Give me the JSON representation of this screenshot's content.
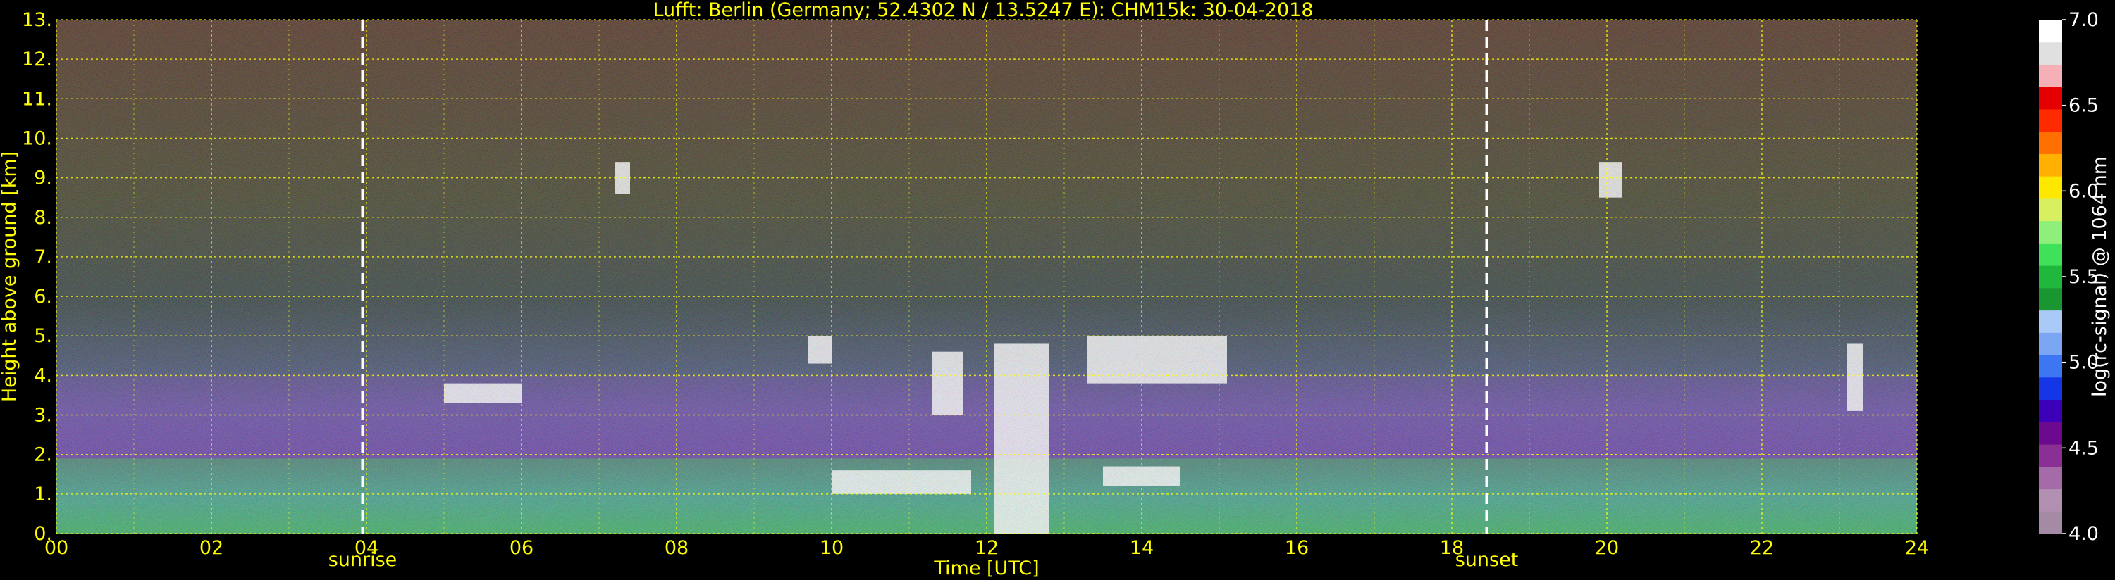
{
  "chart_data": {
    "type": "heatmap",
    "title": "Lufft: Berlin (Germany; 52.4302 N / 13.5247 E):    CHM15k: 30-04-2018",
    "xlabel": "Time [UTC]",
    "ylabel": "Height above ground [km]",
    "colorbar_label": "log(rc-signal) @ 1064 nm",
    "xlim": [
      0,
      24
    ],
    "ylim": [
      0,
      13
    ],
    "xticks": [
      "00",
      "02",
      "04",
      "06",
      "08",
      "10",
      "12",
      "14",
      "16",
      "18",
      "20",
      "22",
      "24"
    ],
    "yticks": [
      "0.",
      "1.",
      "2.",
      "3.",
      "4.",
      "5.",
      "6.",
      "7.",
      "8.",
      "9.",
      "10.",
      "11.",
      "12.",
      "13."
    ],
    "colorbar_ticks": [
      "4.0",
      "4.5",
      "5.0",
      "5.5",
      "6.0",
      "6.5",
      "7.0"
    ],
    "colorbar_range": [
      4.0,
      7.0
    ],
    "grid": true,
    "events": [
      {
        "label": "sunrise",
        "time": 3.95
      },
      {
        "label": "sunset",
        "time": 18.45
      }
    ],
    "colors": {
      "text": "#ffff00",
      "grid": "#ffff00",
      "event_line": "#ffffff",
      "colorbar_text": "#ffffff"
    },
    "colormap": [
      "#a48aa4",
      "#b190b1",
      "#a56aa8",
      "#8a2f93",
      "#6b0a8e",
      "#3c00b9",
      "#1436e6",
      "#3c76f2",
      "#7aa6f4",
      "#a9c9f6",
      "#1a9631",
      "#1fb83c",
      "#3fe05a",
      "#8ef07a",
      "#d8f060",
      "#ffe800",
      "#ffb000",
      "#ff7000",
      "#ff2a00",
      "#e40000",
      "#f4b0b6",
      "#e0e0e0",
      "#ffffff"
    ],
    "features": [
      {
        "kind": "boundary_layer",
        "time_range": [
          0,
          24
        ],
        "height_km": [
          0,
          1.9
        ]
      },
      {
        "kind": "residual_layer",
        "time_range": [
          0,
          24
        ],
        "height_km": [
          1.9,
          4.0
        ]
      },
      {
        "kind": "cloud",
        "time_range": [
          5.0,
          6.0
        ],
        "height_km": [
          3.3,
          3.8
        ]
      },
      {
        "kind": "cloud",
        "time_range": [
          9.7,
          10.0
        ],
        "height_km": [
          4.3,
          5.0
        ]
      },
      {
        "kind": "cloud",
        "time_range": [
          10.0,
          11.8
        ],
        "height_km": [
          1.0,
          1.6
        ]
      },
      {
        "kind": "cloud",
        "time_range": [
          11.3,
          11.7
        ],
        "height_km": [
          3.0,
          4.6
        ]
      },
      {
        "kind": "cloud",
        "time_range": [
          12.1,
          12.8
        ],
        "height_km": [
          0,
          4.8
        ]
      },
      {
        "kind": "cloud",
        "time_range": [
          13.3,
          15.1
        ],
        "height_km": [
          3.8,
          5.0
        ]
      },
      {
        "kind": "cloud",
        "time_range": [
          13.5,
          14.5
        ],
        "height_km": [
          1.2,
          1.7
        ]
      },
      {
        "kind": "cloud",
        "time_range": [
          7.2,
          7.4
        ],
        "height_km": [
          8.6,
          9.4
        ]
      },
      {
        "kind": "cloud",
        "time_range": [
          19.9,
          20.2
        ],
        "height_km": [
          8.5,
          9.4
        ]
      },
      {
        "kind": "cloud",
        "time_range": [
          23.1,
          23.3
        ],
        "height_km": [
          3.1,
          4.8
        ]
      }
    ]
  }
}
